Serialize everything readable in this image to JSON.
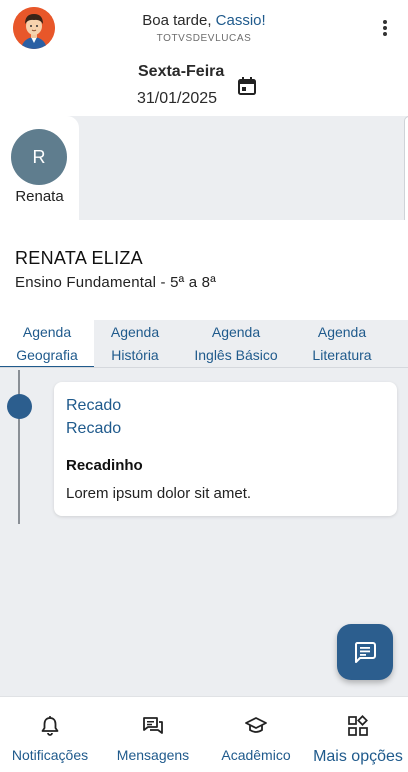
{
  "header": {
    "greeting_prefix": "Boa tarde, ",
    "greeting_name": "Cassio!",
    "subtitle": "TOTVSDEVLUCAS",
    "day": "Sexta-Feira",
    "date": "31/01/2025"
  },
  "students": [
    {
      "initial": "R",
      "name": "Renata"
    }
  ],
  "student_info": {
    "full_name": "RENATA ELIZA",
    "level": "Ensino Fundamental - 5ª a 8ª"
  },
  "tabs": [
    {
      "line1": "Agenda",
      "line2": "Geografia",
      "active": true
    },
    {
      "line1": "Agenda",
      "line2": "História",
      "active": false
    },
    {
      "line1": "Agenda",
      "line2": "Inglês Básico",
      "active": false
    },
    {
      "line1": "Agenda",
      "line2": "Literatura",
      "active": false
    }
  ],
  "messages": [
    {
      "line1": "Recado",
      "line2": "Recado",
      "title": "Recadinho",
      "body": "Lorem ipsum dolor sit amet."
    }
  ],
  "bottom_nav": [
    {
      "label": "Notificações",
      "icon": "bell-icon"
    },
    {
      "label": "Mensagens",
      "icon": "chat-icon"
    },
    {
      "label": "Acadêmico",
      "icon": "graduation-cap-icon"
    },
    {
      "label": "Mais opções",
      "icon": "apps-icon"
    }
  ],
  "colors": {
    "accent": "#1f5a8c",
    "fab": "#2c5e8e",
    "background": "#eceef1",
    "student_avatar": "#5f7d8e"
  }
}
